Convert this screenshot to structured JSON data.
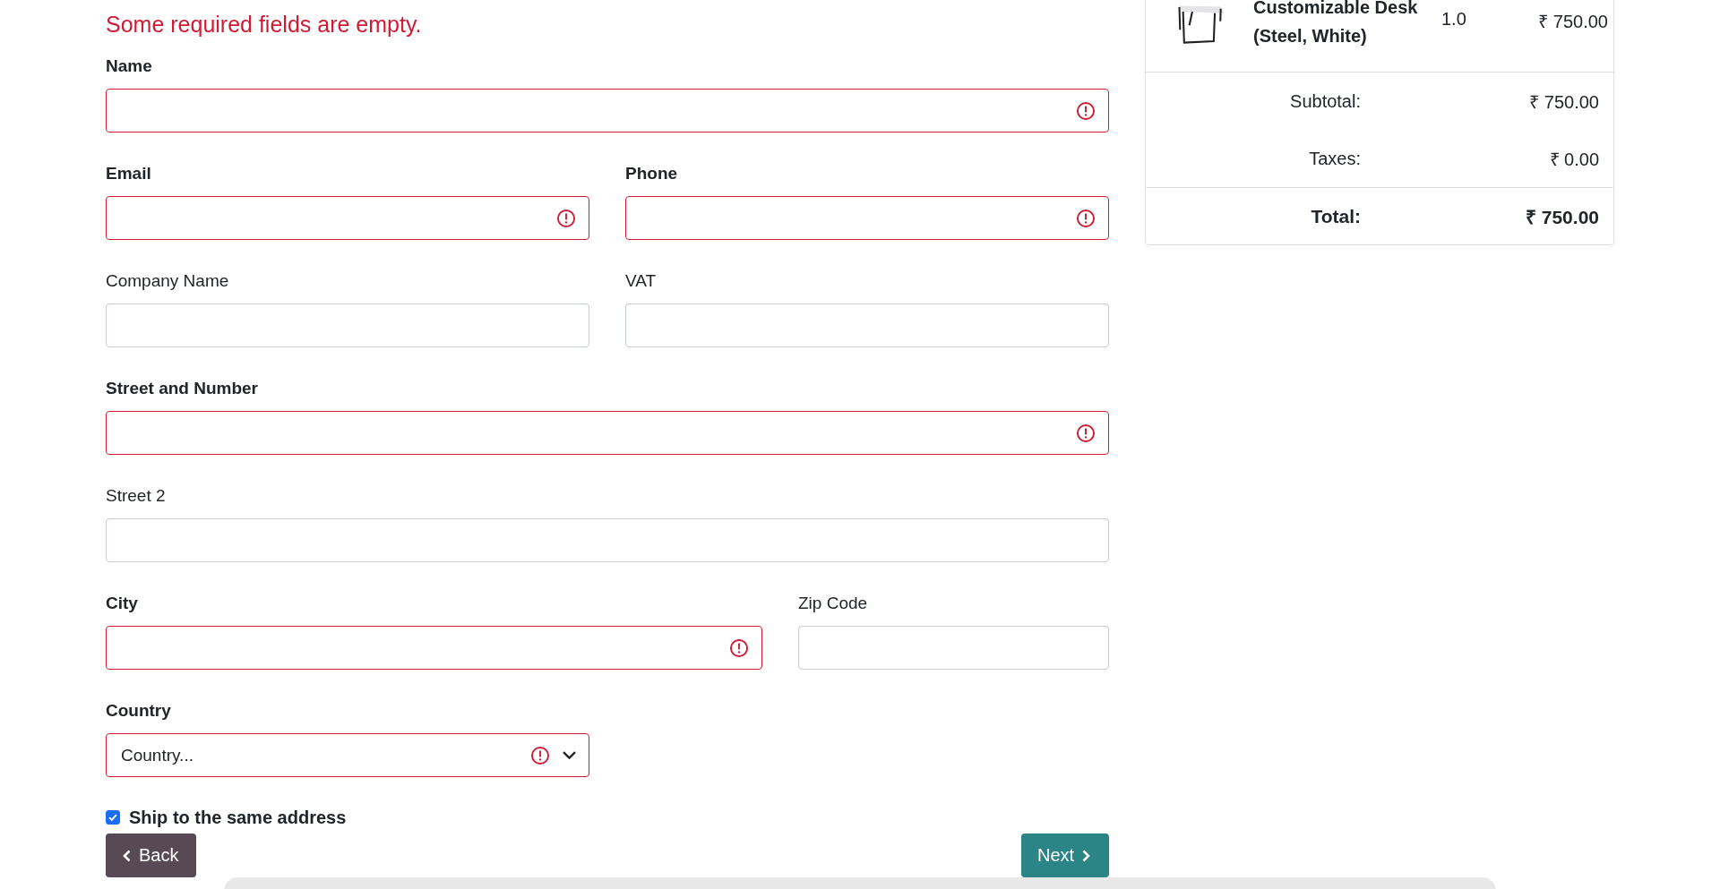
{
  "error_message": "Some required fields are empty.",
  "form_rows": [
    {
      "kind": "full",
      "fields": [
        {
          "kind": "text",
          "label": "Name",
          "required": true,
          "invalid": true
        }
      ]
    },
    {
      "kind": "pair",
      "fields": [
        {
          "kind": "text",
          "label": "Email",
          "required": true,
          "invalid": true
        },
        {
          "kind": "text",
          "label": "Phone",
          "required": true,
          "invalid": true
        }
      ]
    },
    {
      "kind": "pair",
      "fields": [
        {
          "kind": "text",
          "label": "Company Name",
          "required": false,
          "invalid": false
        },
        {
          "kind": "text",
          "label": "VAT",
          "required": false,
          "invalid": false
        }
      ]
    },
    {
      "kind": "full",
      "fields": [
        {
          "kind": "text",
          "label": "Street and Number",
          "required": true,
          "invalid": true
        }
      ]
    },
    {
      "kind": "full",
      "fields": [
        {
          "kind": "text",
          "label": "Street 2",
          "required": false,
          "invalid": false
        }
      ]
    },
    {
      "kind": "wide-pair",
      "fields": [
        {
          "kind": "text",
          "label": "City",
          "required": true,
          "invalid": true
        },
        {
          "kind": "text",
          "label": "Zip Code",
          "required": false,
          "invalid": false
        }
      ]
    },
    {
      "kind": "short",
      "fields": [
        {
          "kind": "select",
          "label": "Country",
          "value": "Country...",
          "required": true,
          "invalid": true
        }
      ]
    }
  ],
  "ship_same_address": {
    "label": "Ship to the same address",
    "checked": true
  },
  "buttons": {
    "back": "Back",
    "next": "Next"
  },
  "cart": {
    "items": [
      {
        "name": "Customizable Desk (Steel, White)",
        "quantity": "1.0",
        "price": "₹ 750.00"
      }
    ],
    "subtotal": {
      "label": "Subtotal:",
      "value": "₹ 750.00"
    },
    "taxes": {
      "label": "Taxes:",
      "value": "₹ 0.00"
    },
    "total": {
      "label": "Total:",
      "value": "₹ 750.00"
    }
  }
}
